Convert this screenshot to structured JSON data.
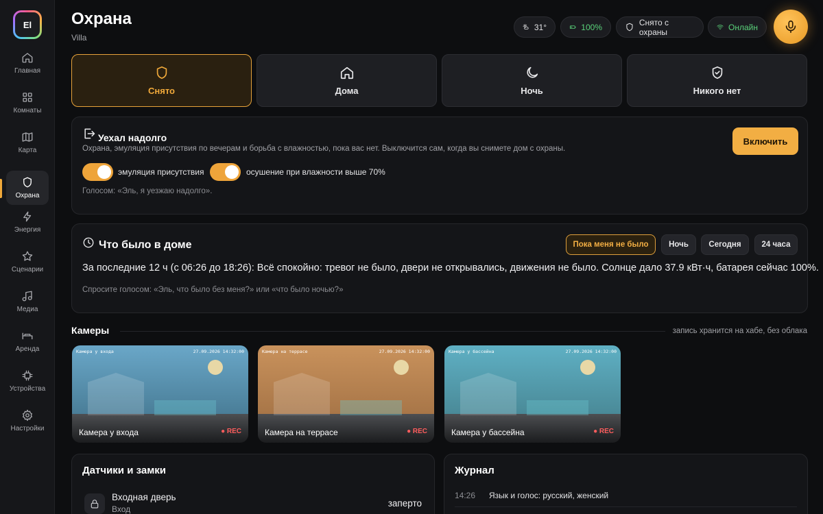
{
  "logo": {
    "text": "El"
  },
  "nav": [
    {
      "label": "Главная",
      "icon": "home-icon"
    },
    {
      "label": "Комнаты",
      "icon": "grid-icon"
    },
    {
      "label": "Карта",
      "icon": "map-icon"
    },
    {
      "label": "Охрана",
      "icon": "shield-icon",
      "active": true
    },
    {
      "label": "Энергия",
      "icon": "bolt-icon"
    },
    {
      "label": "Сценарии",
      "icon": "star-icon"
    },
    {
      "label": "Медиа",
      "icon": "music-icon"
    },
    {
      "label": "Аренда",
      "icon": "bed-icon"
    },
    {
      "label": "Устройства",
      "icon": "chip-icon"
    },
    {
      "label": "Настройки",
      "icon": "gear-icon"
    }
  ],
  "header": {
    "title": "Охрана",
    "subtitle": "Villa",
    "weather": "31°",
    "battery": "100%",
    "arm_status": "Снято с охраны",
    "connection": "Онлайн"
  },
  "colors": {
    "accent": "#f2ae43",
    "online": "#5ad27a",
    "rec": "#ff5d5d"
  },
  "modes": [
    {
      "label": "Снято",
      "icon": "shield-icon",
      "active": true
    },
    {
      "label": "Дома",
      "icon": "home-icon"
    },
    {
      "label": "Ночь",
      "icon": "moon-icon"
    },
    {
      "label": "Никого нет",
      "icon": "shield-check-icon"
    }
  ],
  "away": {
    "title": "Уехал надолго",
    "description": "Охрана, эмуляция присутствия по вечерам и борьба с влажностью, пока вас нет. Выключится сам, когда вы снимете дом с охраны.",
    "button": "Включить",
    "toggle1": "эмуляция присутствия",
    "toggle2": "осушение при влажности выше 70%",
    "voice_hint": "Голосом: «Эль, я уезжаю надолго»."
  },
  "history": {
    "title": "Что было в доме",
    "filters": [
      "Пока меня не было",
      "Ночь",
      "Сегодня",
      "24 часа"
    ],
    "summary": "За последние 12 ч (с 06:26 до 18:26): Всё спокойно: тревог не было, двери не открывались, движения не было. Солнце дало 37.9 кВт·ч, батарея сейчас 100%.",
    "hint": "Спросите голосом: «Эль, что было без меня?» или «что было ночью?»"
  },
  "cameras": {
    "title": "Камеры",
    "note": "запись хранится на хабе, без облака",
    "items": [
      {
        "name": "Камера у входа",
        "osd_name": "Камера у входа",
        "timestamp": "27.09.2026 14:32:00",
        "rec": "● REC",
        "sky": "#6aa7c8"
      },
      {
        "name": "Камера на террасе",
        "osd_name": "Камера на террасе",
        "timestamp": "27.09.2026 14:32:00",
        "rec": "● REC",
        "sky": "#c9925c"
      },
      {
        "name": "Камера у бассейна",
        "osd_name": "Камера у бассейна",
        "timestamp": "27.09.2026 14:32:00",
        "rec": "● REC",
        "sky": "#5fb0c4"
      }
    ]
  },
  "sensors": {
    "title": "Датчики и замки",
    "items": [
      {
        "name": "Входная дверь",
        "location": "Вход",
        "state": "заперто",
        "icon": "lock-icon"
      }
    ]
  },
  "journal": {
    "title": "Журнал",
    "items": [
      {
        "time": "14:26",
        "text": "Язык и голос: русский, женский"
      }
    ]
  }
}
